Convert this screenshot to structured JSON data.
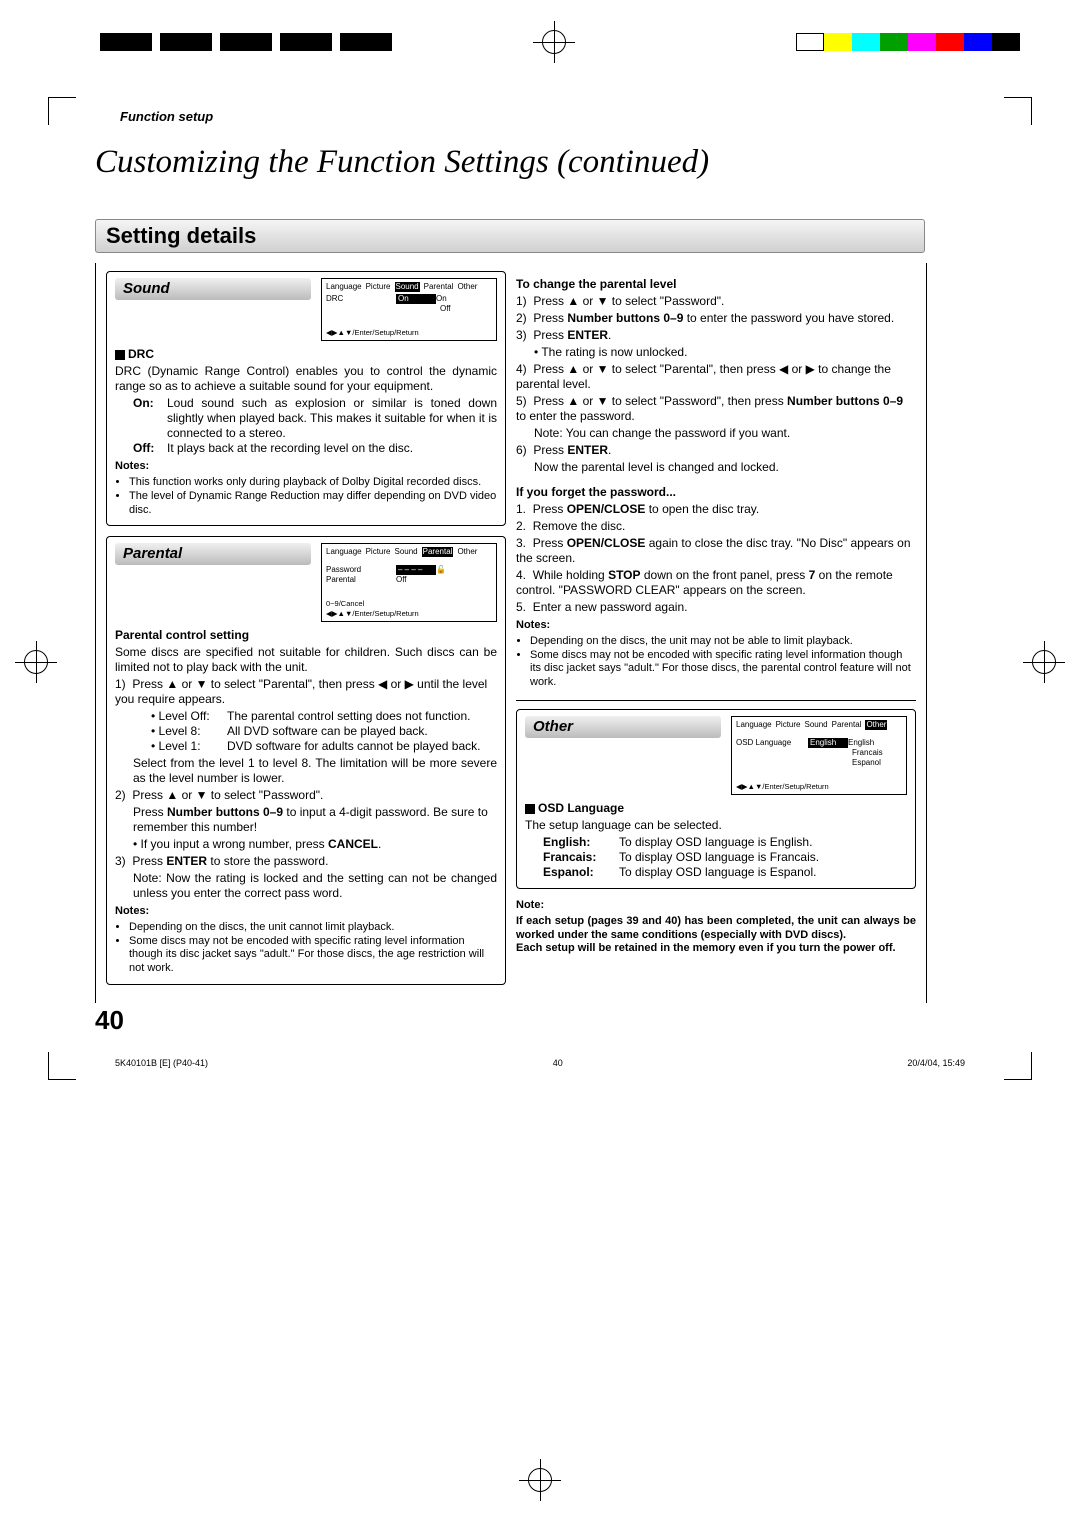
{
  "header": {
    "section_label": "Function setup",
    "main_title": "Customizing the Function Settings (continued)",
    "section_bar": "Setting details"
  },
  "sound": {
    "title": "Sound",
    "osd_tabs": [
      "Language",
      "Picture",
      "Sound",
      "Parental",
      "Other"
    ],
    "osd_row_label": "DRC",
    "osd_row_sel": "On",
    "osd_row_opts": [
      "On",
      "Off"
    ],
    "osd_foot": "◀▶▲▼/Enter/Setup/Return",
    "drc_head": "DRC",
    "drc_desc": "DRC (Dynamic Range Control) enables you to control the dynamic range so as to achieve a suitable sound for your equipment.",
    "drc_on_label": "On:",
    "drc_on_text": "Loud sound such as explosion or similar is toned down slightly when played back. This makes it suitable for when it is connected to a stereo.",
    "drc_off_label": "Off:",
    "drc_off_text": "It plays back at the recording level on the disc.",
    "notes_head": "Notes:",
    "notes": [
      "This function works only during playback of Dolby Digital recorded discs.",
      "The level of Dynamic Range Reduction may differ depending on DVD video disc."
    ]
  },
  "parental": {
    "title": "Parental",
    "osd_tabs": [
      "Language",
      "Picture",
      "Sound",
      "Parental",
      "Other"
    ],
    "osd_pw_label": "Password",
    "osd_pw_val": "– – – –",
    "osd_par_label": "Parental",
    "osd_par_val": "Off",
    "osd_foot1": "0~9/Cancel",
    "osd_foot2": "◀▶▲▼/Enter/Setup/Return",
    "pcs_head": "Parental control setting",
    "pcs_desc": "Some discs are specified not suitable for children. Such discs can be limited not to play back with the unit.",
    "step1_a": "Press ▲ or ▼ to select \"Parental\", then press ◀ or ▶ until the level you require appears.",
    "lv_off_l": "• Level Off:",
    "lv_off_t": "The parental control setting does not function.",
    "lv_8_l": "• Level 8:",
    "lv_8_t": "All DVD software can be played back.",
    "lv_1_l": "• Level 1:",
    "lv_1_t": "DVD software for adults cannot be played back.",
    "step1_sel": "Select from the level 1 to level 8. The limitation will be more severe as the level number is lower.",
    "step2_a": "Press ▲ or ▼ to select \"Password\".",
    "step2_b": "Press Number buttons 0–9 to input a 4-digit password. Be sure to remember this number!",
    "step2_c": "• If you input a wrong number, press CANCEL.",
    "step3_a": "Press ENTER to store the password.",
    "step3_b": "Note: Now the rating is locked and the setting can not be changed unless you enter the correct pass word.",
    "notes_head": "Notes:",
    "notes": [
      "Depending on the discs, the unit cannot limit playback.",
      "Some discs may not be encoded with specific rating level information though its disc jacket says \"adult.\" For those discs, the age restriction will not work."
    ]
  },
  "right": {
    "change_head": "To change the parental level",
    "c1": "Press ▲ or ▼ to select \"Password\".",
    "c2": "Press Number buttons 0–9 to enter the password you have stored.",
    "c3a": "Press ENTER.",
    "c3b": "• The rating is now unlocked.",
    "c4": "Press ▲ or ▼ to select \"Parental\", then press ◀ or ▶ to change the parental level.",
    "c5a": "Press ▲ or ▼ to select \"Password\", then press Number buttons 0–9 to enter the password.",
    "c5b": "Note: You can change the password if you want.",
    "c6a": "Press ENTER.",
    "c6b": "Now the parental level is changed and locked.",
    "forget_head": "If you forget the password...",
    "f1": "Press OPEN/CLOSE to open the disc tray.",
    "f2": "Remove the disc.",
    "f3": "Press OPEN/CLOSE again to close the disc tray. \"No Disc\" appears on the screen.",
    "f4": "While holding STOP down on the front panel, press 7 on the remote control. \"PASSWORD CLEAR\" appears on the screen.",
    "f5": "Enter a new password again.",
    "notes_head": "Notes:",
    "notes": [
      "Depending on the discs, the unit may not be able to limit playback.",
      "Some discs may not be encoded with specific rating level information though its disc jacket says \"adult.\" For those discs, the parental control feature will not work."
    ]
  },
  "other": {
    "title": "Other",
    "osd_tabs": [
      "Language",
      "Picture",
      "Sound",
      "Parental",
      "Other"
    ],
    "osd_label": "OSD Language",
    "osd_sel": "English",
    "osd_opts": [
      "English",
      "Francais",
      "Espanol"
    ],
    "osd_foot": "◀▶▲▼/Enter/Setup/Return",
    "osd_head": "OSD Language",
    "osd_desc": "The setup language can be selected.",
    "en_l": "English:",
    "en_t": "To display OSD language is English.",
    "fr_l": "Francais:",
    "fr_t": "To display OSD language is Francais.",
    "es_l": "Espanol:",
    "es_t": "To display OSD language is Espanol.",
    "note_head": "Note:",
    "note_body": "If each setup (pages 39 and 40) has been completed, the unit can always be worked under the same conditions (especially with DVD discs).\nEach setup will be retained in the memory even if you turn the power off."
  },
  "footer": {
    "page_num": "40",
    "meta_left": "5K40101B [E] (P40-41)",
    "meta_mid": "40",
    "meta_right": "20/4/04, 15:49"
  }
}
